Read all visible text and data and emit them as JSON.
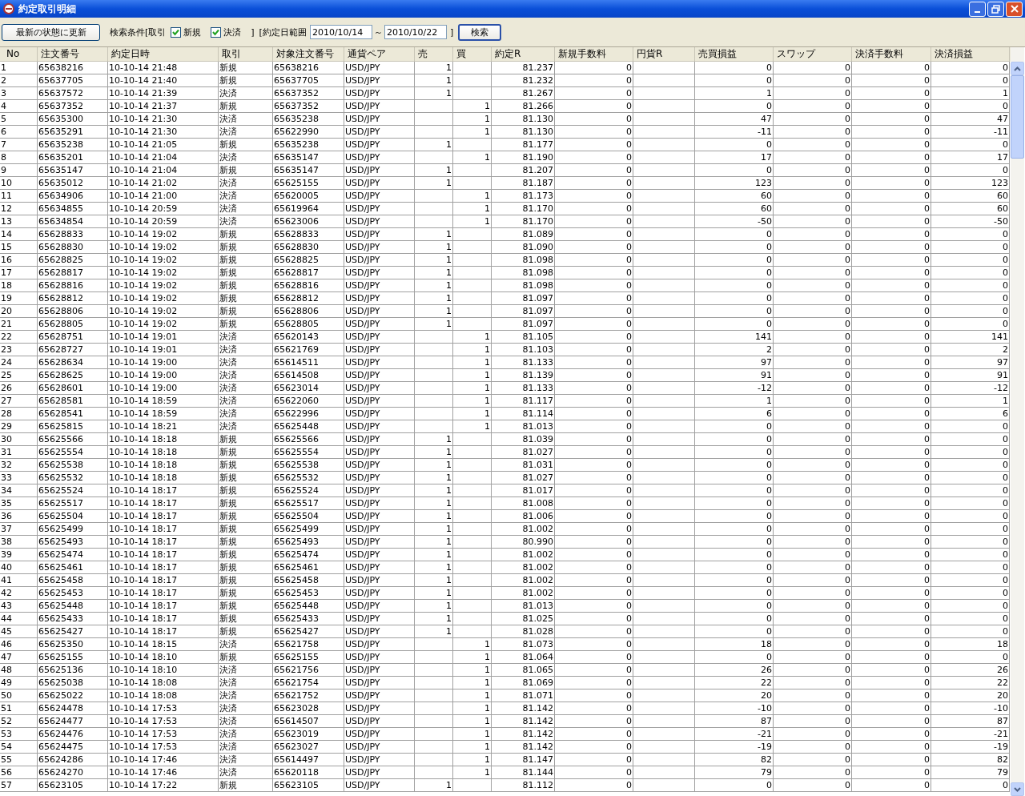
{
  "window": {
    "title": "約定取引明細"
  },
  "toolbar": {
    "refresh_button": "最新の状態に更新",
    "filter_label": "検索条件[取引",
    "filters": [
      {
        "label": "新規",
        "checked": true
      },
      {
        "label": "決済",
        "checked": true
      }
    ],
    "filter_close": "]",
    "date_label": "[約定日範囲",
    "date_from": "2010/10/14",
    "date_separator": "～",
    "date_to": "2010/10/22",
    "date_close": "]",
    "search_button": "検索"
  },
  "table": {
    "columns": [
      "No",
      "注文番号",
      "約定日時",
      "取引",
      "対象注文番号",
      "通貨ペア",
      "売",
      "買",
      "約定R",
      "新規手数料",
      "円貨R",
      "売買損益",
      "スワップ",
      "決済手数料",
      "決済損益"
    ],
    "rows": [
      [
        "1",
        "65638216",
        "10-10-14 21:48",
        "新規",
        "65638216",
        "USD/JPY",
        "1",
        null,
        "81.237",
        "0",
        null,
        "0",
        "0",
        "0",
        "0"
      ],
      [
        "2",
        "65637705",
        "10-10-14 21:40",
        "新規",
        "65637705",
        "USD/JPY",
        "1",
        null,
        "81.232",
        "0",
        null,
        "0",
        "0",
        "0",
        "0"
      ],
      [
        "3",
        "65637572",
        "10-10-14 21:39",
        "決済",
        "65637352",
        "USD/JPY",
        "1",
        null,
        "81.267",
        "0",
        null,
        "1",
        "0",
        "0",
        "1"
      ],
      [
        "4",
        "65637352",
        "10-10-14 21:37",
        "新規",
        "65637352",
        "USD/JPY",
        null,
        "1",
        "81.266",
        "0",
        null,
        "0",
        "0",
        "0",
        "0"
      ],
      [
        "5",
        "65635300",
        "10-10-14 21:30",
        "決済",
        "65635238",
        "USD/JPY",
        null,
        "1",
        "81.130",
        "0",
        null,
        "47",
        "0",
        "0",
        "47"
      ],
      [
        "6",
        "65635291",
        "10-10-14 21:30",
        "決済",
        "65622990",
        "USD/JPY",
        null,
        "1",
        "81.130",
        "0",
        null,
        "-11",
        "0",
        "0",
        "-11"
      ],
      [
        "7",
        "65635238",
        "10-10-14 21:05",
        "新規",
        "65635238",
        "USD/JPY",
        "1",
        null,
        "81.177",
        "0",
        null,
        "0",
        "0",
        "0",
        "0"
      ],
      [
        "8",
        "65635201",
        "10-10-14 21:04",
        "決済",
        "65635147",
        "USD/JPY",
        null,
        "1",
        "81.190",
        "0",
        null,
        "17",
        "0",
        "0",
        "17"
      ],
      [
        "9",
        "65635147",
        "10-10-14 21:04",
        "新規",
        "65635147",
        "USD/JPY",
        "1",
        null,
        "81.207",
        "0",
        null,
        "0",
        "0",
        "0",
        "0"
      ],
      [
        "10",
        "65635012",
        "10-10-14 21:02",
        "決済",
        "65625155",
        "USD/JPY",
        "1",
        null,
        "81.187",
        "0",
        null,
        "123",
        "0",
        "0",
        "123"
      ],
      [
        "11",
        "65634906",
        "10-10-14 21:00",
        "決済",
        "65620005",
        "USD/JPY",
        null,
        "1",
        "81.173",
        "0",
        null,
        "60",
        "0",
        "0",
        "60"
      ],
      [
        "12",
        "65634855",
        "10-10-14 20:59",
        "決済",
        "65619964",
        "USD/JPY",
        null,
        "1",
        "81.170",
        "0",
        null,
        "60",
        "0",
        "0",
        "60"
      ],
      [
        "13",
        "65634854",
        "10-10-14 20:59",
        "決済",
        "65623006",
        "USD/JPY",
        null,
        "1",
        "81.170",
        "0",
        null,
        "-50",
        "0",
        "0",
        "-50"
      ],
      [
        "14",
        "65628833",
        "10-10-14 19:02",
        "新規",
        "65628833",
        "USD/JPY",
        "1",
        null,
        "81.089",
        "0",
        null,
        "0",
        "0",
        "0",
        "0"
      ],
      [
        "15",
        "65628830",
        "10-10-14 19:02",
        "新規",
        "65628830",
        "USD/JPY",
        "1",
        null,
        "81.090",
        "0",
        null,
        "0",
        "0",
        "0",
        "0"
      ],
      [
        "16",
        "65628825",
        "10-10-14 19:02",
        "新規",
        "65628825",
        "USD/JPY",
        "1",
        null,
        "81.098",
        "0",
        null,
        "0",
        "0",
        "0",
        "0"
      ],
      [
        "17",
        "65628817",
        "10-10-14 19:02",
        "新規",
        "65628817",
        "USD/JPY",
        "1",
        null,
        "81.098",
        "0",
        null,
        "0",
        "0",
        "0",
        "0"
      ],
      [
        "18",
        "65628816",
        "10-10-14 19:02",
        "新規",
        "65628816",
        "USD/JPY",
        "1",
        null,
        "81.098",
        "0",
        null,
        "0",
        "0",
        "0",
        "0"
      ],
      [
        "19",
        "65628812",
        "10-10-14 19:02",
        "新規",
        "65628812",
        "USD/JPY",
        "1",
        null,
        "81.097",
        "0",
        null,
        "0",
        "0",
        "0",
        "0"
      ],
      [
        "20",
        "65628806",
        "10-10-14 19:02",
        "新規",
        "65628806",
        "USD/JPY",
        "1",
        null,
        "81.097",
        "0",
        null,
        "0",
        "0",
        "0",
        "0"
      ],
      [
        "21",
        "65628805",
        "10-10-14 19:02",
        "新規",
        "65628805",
        "USD/JPY",
        "1",
        null,
        "81.097",
        "0",
        null,
        "0",
        "0",
        "0",
        "0"
      ],
      [
        "22",
        "65628751",
        "10-10-14 19:01",
        "決済",
        "65620143",
        "USD/JPY",
        null,
        "1",
        "81.105",
        "0",
        null,
        "141",
        "0",
        "0",
        "141"
      ],
      [
        "23",
        "65628727",
        "10-10-14 19:01",
        "決済",
        "65621769",
        "USD/JPY",
        null,
        "1",
        "81.103",
        "0",
        null,
        "2",
        "0",
        "0",
        "2"
      ],
      [
        "24",
        "65628634",
        "10-10-14 19:00",
        "決済",
        "65614511",
        "USD/JPY",
        null,
        "1",
        "81.133",
        "0",
        null,
        "97",
        "0",
        "0",
        "97"
      ],
      [
        "25",
        "65628625",
        "10-10-14 19:00",
        "決済",
        "65614508",
        "USD/JPY",
        null,
        "1",
        "81.139",
        "0",
        null,
        "91",
        "0",
        "0",
        "91"
      ],
      [
        "26",
        "65628601",
        "10-10-14 19:00",
        "決済",
        "65623014",
        "USD/JPY",
        null,
        "1",
        "81.133",
        "0",
        null,
        "-12",
        "0",
        "0",
        "-12"
      ],
      [
        "27",
        "65628581",
        "10-10-14 18:59",
        "決済",
        "65622060",
        "USD/JPY",
        null,
        "1",
        "81.117",
        "0",
        null,
        "1",
        "0",
        "0",
        "1"
      ],
      [
        "28",
        "65628541",
        "10-10-14 18:59",
        "決済",
        "65622996",
        "USD/JPY",
        null,
        "1",
        "81.114",
        "0",
        null,
        "6",
        "0",
        "0",
        "6"
      ],
      [
        "29",
        "65625815",
        "10-10-14 18:21",
        "決済",
        "65625448",
        "USD/JPY",
        null,
        "1",
        "81.013",
        "0",
        null,
        "0",
        "0",
        "0",
        "0"
      ],
      [
        "30",
        "65625566",
        "10-10-14 18:18",
        "新規",
        "65625566",
        "USD/JPY",
        "1",
        null,
        "81.039",
        "0",
        null,
        "0",
        "0",
        "0",
        "0"
      ],
      [
        "31",
        "65625554",
        "10-10-14 18:18",
        "新規",
        "65625554",
        "USD/JPY",
        "1",
        null,
        "81.027",
        "0",
        null,
        "0",
        "0",
        "0",
        "0"
      ],
      [
        "32",
        "65625538",
        "10-10-14 18:18",
        "新規",
        "65625538",
        "USD/JPY",
        "1",
        null,
        "81.031",
        "0",
        null,
        "0",
        "0",
        "0",
        "0"
      ],
      [
        "33",
        "65625532",
        "10-10-14 18:18",
        "新規",
        "65625532",
        "USD/JPY",
        "1",
        null,
        "81.027",
        "0",
        null,
        "0",
        "0",
        "0",
        "0"
      ],
      [
        "34",
        "65625524",
        "10-10-14 18:17",
        "新規",
        "65625524",
        "USD/JPY",
        "1",
        null,
        "81.017",
        "0",
        null,
        "0",
        "0",
        "0",
        "0"
      ],
      [
        "35",
        "65625517",
        "10-10-14 18:17",
        "新規",
        "65625517",
        "USD/JPY",
        "1",
        null,
        "81.008",
        "0",
        null,
        "0",
        "0",
        "0",
        "0"
      ],
      [
        "36",
        "65625504",
        "10-10-14 18:17",
        "新規",
        "65625504",
        "USD/JPY",
        "1",
        null,
        "81.006",
        "0",
        null,
        "0",
        "0",
        "0",
        "0"
      ],
      [
        "37",
        "65625499",
        "10-10-14 18:17",
        "新規",
        "65625499",
        "USD/JPY",
        "1",
        null,
        "81.002",
        "0",
        null,
        "0",
        "0",
        "0",
        "0"
      ],
      [
        "38",
        "65625493",
        "10-10-14 18:17",
        "新規",
        "65625493",
        "USD/JPY",
        "1",
        null,
        "80.990",
        "0",
        null,
        "0",
        "0",
        "0",
        "0"
      ],
      [
        "39",
        "65625474",
        "10-10-14 18:17",
        "新規",
        "65625474",
        "USD/JPY",
        "1",
        null,
        "81.002",
        "0",
        null,
        "0",
        "0",
        "0",
        "0"
      ],
      [
        "40",
        "65625461",
        "10-10-14 18:17",
        "新規",
        "65625461",
        "USD/JPY",
        "1",
        null,
        "81.002",
        "0",
        null,
        "0",
        "0",
        "0",
        "0"
      ],
      [
        "41",
        "65625458",
        "10-10-14 18:17",
        "新規",
        "65625458",
        "USD/JPY",
        "1",
        null,
        "81.002",
        "0",
        null,
        "0",
        "0",
        "0",
        "0"
      ],
      [
        "42",
        "65625453",
        "10-10-14 18:17",
        "新規",
        "65625453",
        "USD/JPY",
        "1",
        null,
        "81.002",
        "0",
        null,
        "0",
        "0",
        "0",
        "0"
      ],
      [
        "43",
        "65625448",
        "10-10-14 18:17",
        "新規",
        "65625448",
        "USD/JPY",
        "1",
        null,
        "81.013",
        "0",
        null,
        "0",
        "0",
        "0",
        "0"
      ],
      [
        "44",
        "65625433",
        "10-10-14 18:17",
        "新規",
        "65625433",
        "USD/JPY",
        "1",
        null,
        "81.025",
        "0",
        null,
        "0",
        "0",
        "0",
        "0"
      ],
      [
        "45",
        "65625427",
        "10-10-14 18:17",
        "新規",
        "65625427",
        "USD/JPY",
        "1",
        null,
        "81.028",
        "0",
        null,
        "0",
        "0",
        "0",
        "0"
      ],
      [
        "46",
        "65625350",
        "10-10-14 18:15",
        "決済",
        "65621758",
        "USD/JPY",
        null,
        "1",
        "81.073",
        "0",
        null,
        "18",
        "0",
        "0",
        "18"
      ],
      [
        "47",
        "65625155",
        "10-10-14 18:10",
        "新規",
        "65625155",
        "USD/JPY",
        null,
        "1",
        "81.064",
        "0",
        null,
        "0",
        "0",
        "0",
        "0"
      ],
      [
        "48",
        "65625136",
        "10-10-14 18:10",
        "決済",
        "65621756",
        "USD/JPY",
        null,
        "1",
        "81.065",
        "0",
        null,
        "26",
        "0",
        "0",
        "26"
      ],
      [
        "49",
        "65625038",
        "10-10-14 18:08",
        "決済",
        "65621754",
        "USD/JPY",
        null,
        "1",
        "81.069",
        "0",
        null,
        "22",
        "0",
        "0",
        "22"
      ],
      [
        "50",
        "65625022",
        "10-10-14 18:08",
        "決済",
        "65621752",
        "USD/JPY",
        null,
        "1",
        "81.071",
        "0",
        null,
        "20",
        "0",
        "0",
        "20"
      ],
      [
        "51",
        "65624478",
        "10-10-14 17:53",
        "決済",
        "65623028",
        "USD/JPY",
        null,
        "1",
        "81.142",
        "0",
        null,
        "-10",
        "0",
        "0",
        "-10"
      ],
      [
        "52",
        "65624477",
        "10-10-14 17:53",
        "決済",
        "65614507",
        "USD/JPY",
        null,
        "1",
        "81.142",
        "0",
        null,
        "87",
        "0",
        "0",
        "87"
      ],
      [
        "53",
        "65624476",
        "10-10-14 17:53",
        "決済",
        "65623019",
        "USD/JPY",
        null,
        "1",
        "81.142",
        "0",
        null,
        "-21",
        "0",
        "0",
        "-21"
      ],
      [
        "54",
        "65624475",
        "10-10-14 17:53",
        "決済",
        "65623027",
        "USD/JPY",
        null,
        "1",
        "81.142",
        "0",
        null,
        "-19",
        "0",
        "0",
        "-19"
      ],
      [
        "55",
        "65624286",
        "10-10-14 17:46",
        "決済",
        "65614497",
        "USD/JPY",
        null,
        "1",
        "81.147",
        "0",
        null,
        "82",
        "0",
        "0",
        "82"
      ],
      [
        "56",
        "65624270",
        "10-10-14 17:46",
        "決済",
        "65620118",
        "USD/JPY",
        null,
        "1",
        "81.144",
        "0",
        null,
        "79",
        "0",
        "0",
        "79"
      ],
      [
        "57",
        "65623105",
        "10-10-14 17:22",
        "新規",
        "65623105",
        "USD/JPY",
        "1",
        null,
        "81.112",
        "0",
        null,
        "0",
        "0",
        "0",
        "0"
      ]
    ]
  }
}
